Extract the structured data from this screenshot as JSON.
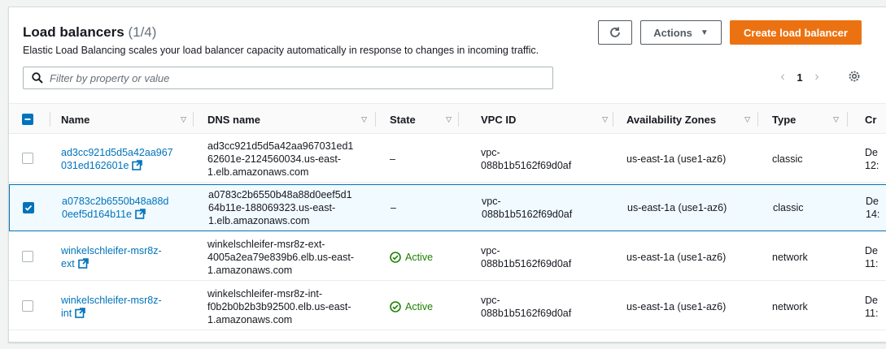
{
  "header": {
    "title": "Load balancers",
    "count": "(1/4)",
    "subtitle": "Elastic Load Balancing scales your load balancer capacity automatically in response to changes in incoming traffic."
  },
  "toolbar": {
    "refresh_icon": "refresh-icon",
    "actions_label": "Actions",
    "create_label": "Create load balancer"
  },
  "search": {
    "placeholder": "Filter by property or value"
  },
  "pagination": {
    "current_page": "1"
  },
  "colors": {
    "accent": "#ec7211",
    "link": "#0073bb",
    "success": "#1d8102",
    "selected_bg": "#f1faff"
  },
  "columns": [
    "Name",
    "DNS name",
    "State",
    "VPC ID",
    "Availability Zones",
    "Type",
    "Cr"
  ],
  "rows": [
    {
      "selected": false,
      "name": "ad3cc921d5d5a42aa967\n031ed162601e",
      "dns": "ad3cc921d5d5a42aa967031ed1\n62601e-2124560034.us-east-\n1.elb.amazonaws.com",
      "state": "–",
      "vpc": "vpc-\n088b1b5162f69d0af",
      "az": "us-east-1a (use1-az6)",
      "type": "classic",
      "created": "De\n12:"
    },
    {
      "selected": true,
      "name": "a0783c2b6550b48a88d\n0eef5d164b11e",
      "dns": "a0783c2b6550b48a88d0eef5d1\n64b11e-188069323.us-east-\n1.elb.amazonaws.com",
      "state": "–",
      "vpc": "vpc-\n088b1b5162f69d0af",
      "az": "us-east-1a (use1-az6)",
      "type": "classic",
      "created": "De\n14:"
    },
    {
      "selected": false,
      "name": "winkelschleifer-msr8z-\next",
      "dns": "winkelschleifer-msr8z-ext-\n4005a2ea79e839b6.elb.us-east-\n1.amazonaws.com",
      "state": "Active",
      "vpc": "vpc-\n088b1b5162f69d0af",
      "az": "us-east-1a (use1-az6)",
      "type": "network",
      "created": "De\n11:"
    },
    {
      "selected": false,
      "name": "winkelschleifer-msr8z-\nint",
      "dns": "winkelschleifer-msr8z-int-\nf0b2b0b2b3b92500.elb.us-east-\n1.amazonaws.com",
      "state": "Active",
      "vpc": "vpc-\n088b1b5162f69d0af",
      "az": "us-east-1a (use1-az6)",
      "type": "network",
      "created": "De\n11:"
    }
  ]
}
